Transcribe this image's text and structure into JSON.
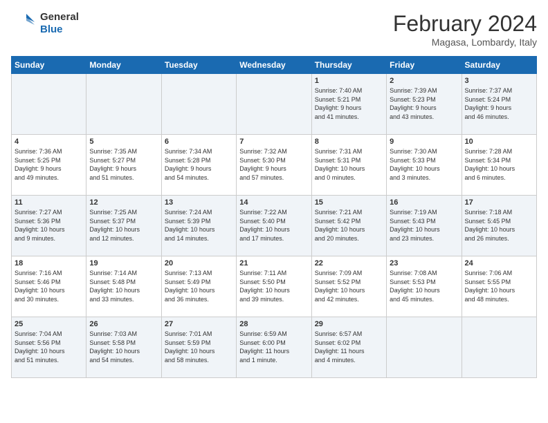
{
  "header": {
    "logo_line1": "General",
    "logo_line2": "Blue",
    "month_title": "February 2024",
    "location": "Magasa, Lombardy, Italy"
  },
  "days_of_week": [
    "Sunday",
    "Monday",
    "Tuesday",
    "Wednesday",
    "Thursday",
    "Friday",
    "Saturday"
  ],
  "weeks": [
    [
      {
        "day": "",
        "detail": ""
      },
      {
        "day": "",
        "detail": ""
      },
      {
        "day": "",
        "detail": ""
      },
      {
        "day": "",
        "detail": ""
      },
      {
        "day": "1",
        "detail": "Sunrise: 7:40 AM\nSunset: 5:21 PM\nDaylight: 9 hours\nand 41 minutes."
      },
      {
        "day": "2",
        "detail": "Sunrise: 7:39 AM\nSunset: 5:23 PM\nDaylight: 9 hours\nand 43 minutes."
      },
      {
        "day": "3",
        "detail": "Sunrise: 7:37 AM\nSunset: 5:24 PM\nDaylight: 9 hours\nand 46 minutes."
      }
    ],
    [
      {
        "day": "4",
        "detail": "Sunrise: 7:36 AM\nSunset: 5:25 PM\nDaylight: 9 hours\nand 49 minutes."
      },
      {
        "day": "5",
        "detail": "Sunrise: 7:35 AM\nSunset: 5:27 PM\nDaylight: 9 hours\nand 51 minutes."
      },
      {
        "day": "6",
        "detail": "Sunrise: 7:34 AM\nSunset: 5:28 PM\nDaylight: 9 hours\nand 54 minutes."
      },
      {
        "day": "7",
        "detail": "Sunrise: 7:32 AM\nSunset: 5:30 PM\nDaylight: 9 hours\nand 57 minutes."
      },
      {
        "day": "8",
        "detail": "Sunrise: 7:31 AM\nSunset: 5:31 PM\nDaylight: 10 hours\nand 0 minutes."
      },
      {
        "day": "9",
        "detail": "Sunrise: 7:30 AM\nSunset: 5:33 PM\nDaylight: 10 hours\nand 3 minutes."
      },
      {
        "day": "10",
        "detail": "Sunrise: 7:28 AM\nSunset: 5:34 PM\nDaylight: 10 hours\nand 6 minutes."
      }
    ],
    [
      {
        "day": "11",
        "detail": "Sunrise: 7:27 AM\nSunset: 5:36 PM\nDaylight: 10 hours\nand 9 minutes."
      },
      {
        "day": "12",
        "detail": "Sunrise: 7:25 AM\nSunset: 5:37 PM\nDaylight: 10 hours\nand 12 minutes."
      },
      {
        "day": "13",
        "detail": "Sunrise: 7:24 AM\nSunset: 5:39 PM\nDaylight: 10 hours\nand 14 minutes."
      },
      {
        "day": "14",
        "detail": "Sunrise: 7:22 AM\nSunset: 5:40 PM\nDaylight: 10 hours\nand 17 minutes."
      },
      {
        "day": "15",
        "detail": "Sunrise: 7:21 AM\nSunset: 5:42 PM\nDaylight: 10 hours\nand 20 minutes."
      },
      {
        "day": "16",
        "detail": "Sunrise: 7:19 AM\nSunset: 5:43 PM\nDaylight: 10 hours\nand 23 minutes."
      },
      {
        "day": "17",
        "detail": "Sunrise: 7:18 AM\nSunset: 5:45 PM\nDaylight: 10 hours\nand 26 minutes."
      }
    ],
    [
      {
        "day": "18",
        "detail": "Sunrise: 7:16 AM\nSunset: 5:46 PM\nDaylight: 10 hours\nand 30 minutes."
      },
      {
        "day": "19",
        "detail": "Sunrise: 7:14 AM\nSunset: 5:48 PM\nDaylight: 10 hours\nand 33 minutes."
      },
      {
        "day": "20",
        "detail": "Sunrise: 7:13 AM\nSunset: 5:49 PM\nDaylight: 10 hours\nand 36 minutes."
      },
      {
        "day": "21",
        "detail": "Sunrise: 7:11 AM\nSunset: 5:50 PM\nDaylight: 10 hours\nand 39 minutes."
      },
      {
        "day": "22",
        "detail": "Sunrise: 7:09 AM\nSunset: 5:52 PM\nDaylight: 10 hours\nand 42 minutes."
      },
      {
        "day": "23",
        "detail": "Sunrise: 7:08 AM\nSunset: 5:53 PM\nDaylight: 10 hours\nand 45 minutes."
      },
      {
        "day": "24",
        "detail": "Sunrise: 7:06 AM\nSunset: 5:55 PM\nDaylight: 10 hours\nand 48 minutes."
      }
    ],
    [
      {
        "day": "25",
        "detail": "Sunrise: 7:04 AM\nSunset: 5:56 PM\nDaylight: 10 hours\nand 51 minutes."
      },
      {
        "day": "26",
        "detail": "Sunrise: 7:03 AM\nSunset: 5:58 PM\nDaylight: 10 hours\nand 54 minutes."
      },
      {
        "day": "27",
        "detail": "Sunrise: 7:01 AM\nSunset: 5:59 PM\nDaylight: 10 hours\nand 58 minutes."
      },
      {
        "day": "28",
        "detail": "Sunrise: 6:59 AM\nSunset: 6:00 PM\nDaylight: 11 hours\nand 1 minute."
      },
      {
        "day": "29",
        "detail": "Sunrise: 6:57 AM\nSunset: 6:02 PM\nDaylight: 11 hours\nand 4 minutes."
      },
      {
        "day": "",
        "detail": ""
      },
      {
        "day": "",
        "detail": ""
      }
    ]
  ]
}
